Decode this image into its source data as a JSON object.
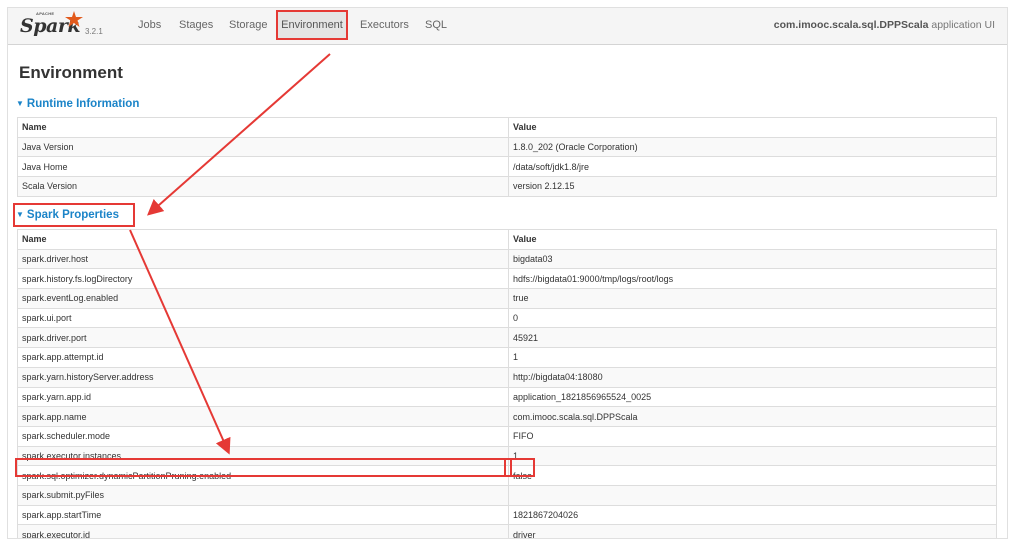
{
  "brand": {
    "apache": "APACHE",
    "name": "Spark",
    "version": "3.2.1"
  },
  "nav": {
    "items": [
      "Jobs",
      "Stages",
      "Storage",
      "Environment",
      "Executors",
      "SQL"
    ],
    "active": "Environment"
  },
  "app_title": {
    "main": "com.imooc.scala.sql.DPPScala",
    "suffix": " application UI"
  },
  "page_title": "Environment",
  "runtime": {
    "heading": "Runtime Information",
    "col_name": "Name",
    "col_value": "Value",
    "rows": [
      [
        "Java Version",
        "1.8.0_202 (Oracle Corporation)"
      ],
      [
        "Java Home",
        "/data/soft/jdk1.8/jre"
      ],
      [
        "Scala Version",
        "version 2.12.15"
      ]
    ]
  },
  "spark_props": {
    "heading": "Spark Properties",
    "col_name": "Name",
    "col_value": "Value",
    "rows": [
      [
        "spark.driver.host",
        "bigdata03"
      ],
      [
        "spark.history.fs.logDirectory",
        "hdfs://bigdata01:9000/tmp/logs/root/logs"
      ],
      [
        "spark.eventLog.enabled",
        "true"
      ],
      [
        "spark.ui.port",
        "0"
      ],
      [
        "spark.driver.port",
        "45921"
      ],
      [
        "spark.app.attempt.id",
        "1"
      ],
      [
        "spark.yarn.historyServer.address",
        "http://bigdata04:18080"
      ],
      [
        "spark.yarn.app.id",
        "application_1821856965524_0025"
      ],
      [
        "spark.app.name",
        "com.imooc.scala.sql.DPPScala"
      ],
      [
        "spark.scheduler.mode",
        "FIFO"
      ],
      [
        "spark.executor.instances",
        "1"
      ],
      [
        "spark.sql.optimizer.dynamicPartitionPruning.enabled",
        "false"
      ],
      [
        "spark.submit.pyFiles",
        ""
      ],
      [
        "spark.app.startTime",
        "1821867204026"
      ],
      [
        "spark.executor.id",
        "driver"
      ]
    ]
  },
  "colors": {
    "accent": "#1b84c8",
    "annotation": "#e53935"
  }
}
